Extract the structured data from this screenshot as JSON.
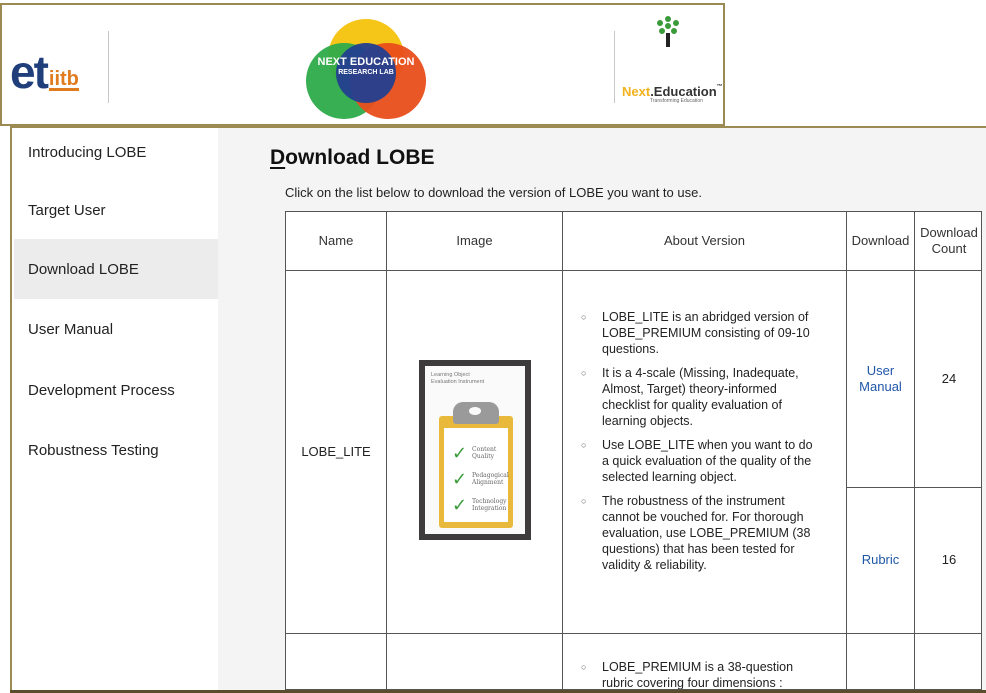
{
  "header": {
    "et_logo": "et",
    "iitb_logo": "iitb",
    "lab_logo_line1": "NEXT EDUCATION",
    "lab_logo_line2": "RESEARCH LAB",
    "ne_logo_part1": "Next",
    "ne_logo_part2": ".Education",
    "ne_logo_tm": "™",
    "ne_tagline": "Transforming Education"
  },
  "sidebar": {
    "items": [
      {
        "label": "Introducing LOBE"
      },
      {
        "label": "Target User"
      },
      {
        "label": "Download LOBE"
      },
      {
        "label": "User Manual"
      },
      {
        "label": "Development Process"
      },
      {
        "label": "Robustness Testing"
      }
    ],
    "active_index": 2
  },
  "main": {
    "title_first_letter": "D",
    "title_rest": "ownload LOBE",
    "intro": "Click on the list below to download the version of LOBE you want to use."
  },
  "table": {
    "headers": {
      "name": "Name",
      "image": "Image",
      "about": "About Version",
      "download": "Download",
      "count_line1": "Download",
      "count_line2": "Count"
    },
    "rows": [
      {
        "name": "LOBE_LITE",
        "about": [
          "LOBE_LITE is an abridged version of LOBE_PREMIUM consisting of 09-10 questions.",
          "It is a 4-scale (Missing, Inadequate, Almost, Target) theory-informed checklist for quality evaluation of learning objects.",
          "Use LOBE_LITE when you want to do a quick evaluation of the quality of the selected learning object.",
          "The robustness of the instrument cannot be vouched for. For thorough evaluation, use LOBE_PREMIUM (38 questions) that has been tested for validity & reliability."
        ],
        "downloads": [
          {
            "label_line1": "User",
            "label_line2": "Manual",
            "count": "24"
          },
          {
            "label": "Rubric",
            "count": "16"
          }
        ],
        "image": {
          "title_line1": "Learning Object",
          "title_line2": "Evaluation Instrument",
          "items": [
            {
              "line1": "Content",
              "line2": "Quality"
            },
            {
              "line1": "Pedagogical",
              "line2": "Alignment"
            },
            {
              "line1": "Technology",
              "line2": "Integration"
            }
          ]
        }
      },
      {
        "about": [
          "LOBE_PREMIUM is a 38-question rubric covering four dimensions :"
        ]
      }
    ]
  },
  "colors": {
    "frame": "#9b8a52",
    "link": "#1f57a8",
    "sidebar_active": "#ececec",
    "main_bg": "#f4f4f4"
  }
}
